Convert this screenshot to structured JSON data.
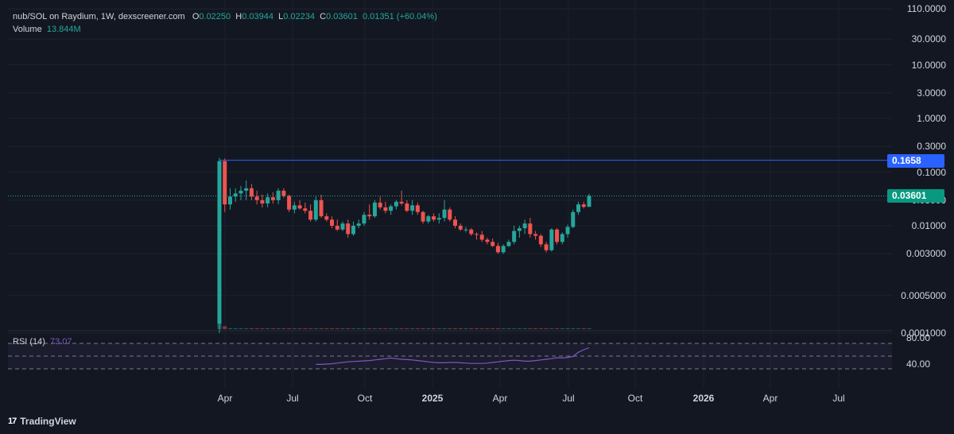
{
  "legend": {
    "pair": "nub/SOL on Raydium, 1W, dexscreener.com",
    "open_key": "O",
    "open": "0.02250",
    "high_key": "H",
    "high": "0.03944",
    "low_key": "L",
    "low": "0.02234",
    "close_key": "C",
    "close": "0.03601",
    "change": "0.01351 (+60.04%)",
    "volume_label": "Volume",
    "volume": "13.844M"
  },
  "rsi_legend": {
    "label": "RSI (14)",
    "value": "73.07",
    "tick_80": "80.00",
    "tick_40": "40.00"
  },
  "price_tags": {
    "line": "0.1658",
    "last": "0.03601"
  },
  "brand": {
    "logo_text": "17",
    "name": "TradingView"
  },
  "colors": {
    "background": "#131722",
    "up": "#26a69a",
    "down": "#ef5350",
    "line": "#2962ff",
    "rsi": "#7e57c2"
  },
  "chart_data": {
    "type": "candlestick",
    "scale": "log",
    "y_ticks": [
      "110.0000",
      "30.0000",
      "10.0000",
      "3.0000",
      "1.0000",
      "0.3000",
      "0.1000",
      "0.03000",
      "0.01000",
      "0.003000",
      "0.0005000",
      "0.0001000"
    ],
    "x_ticks": [
      {
        "label": "Apr",
        "bold": false
      },
      {
        "label": "Jul",
        "bold": false
      },
      {
        "label": "Oct",
        "bold": false
      },
      {
        "label": "2025",
        "bold": true
      },
      {
        "label": "Apr",
        "bold": false
      },
      {
        "label": "Jul",
        "bold": false
      },
      {
        "label": "Oct",
        "bold": false
      },
      {
        "label": "2026",
        "bold": true
      },
      {
        "label": "Apr",
        "bold": false
      },
      {
        "label": "Jul",
        "bold": false
      }
    ],
    "horizontal_line": 0.1658,
    "last_price": 0.03601,
    "candles": [
      [
        0.00015,
        0.185,
        0.0001,
        0.16
      ],
      [
        0.16,
        0.18,
        0.018,
        0.025
      ],
      [
        0.025,
        0.05,
        0.02,
        0.035
      ],
      [
        0.035,
        0.05,
        0.028,
        0.04
      ],
      [
        0.04,
        0.055,
        0.03,
        0.045
      ],
      [
        0.045,
        0.07,
        0.03,
        0.05
      ],
      [
        0.05,
        0.06,
        0.03,
        0.035
      ],
      [
        0.035,
        0.045,
        0.025,
        0.03
      ],
      [
        0.03,
        0.038,
        0.022,
        0.026
      ],
      [
        0.026,
        0.04,
        0.022,
        0.034
      ],
      [
        0.034,
        0.042,
        0.026,
        0.03
      ],
      [
        0.03,
        0.05,
        0.025,
        0.045
      ],
      [
        0.045,
        0.05,
        0.033,
        0.036
      ],
      [
        0.036,
        0.038,
        0.018,
        0.02
      ],
      [
        0.02,
        0.028,
        0.017,
        0.024
      ],
      [
        0.024,
        0.03,
        0.02,
        0.021
      ],
      [
        0.021,
        0.027,
        0.017,
        0.019
      ],
      [
        0.019,
        0.025,
        0.012,
        0.013
      ],
      [
        0.013,
        0.035,
        0.012,
        0.03
      ],
      [
        0.03,
        0.038,
        0.014,
        0.015
      ],
      [
        0.015,
        0.017,
        0.012,
        0.013
      ],
      [
        0.013,
        0.015,
        0.009,
        0.01
      ],
      [
        0.01,
        0.013,
        0.008,
        0.0085
      ],
      [
        0.0085,
        0.012,
        0.008,
        0.011
      ],
      [
        0.011,
        0.013,
        0.006,
        0.007
      ],
      [
        0.007,
        0.012,
        0.0065,
        0.01
      ],
      [
        0.01,
        0.013,
        0.009,
        0.011
      ],
      [
        0.011,
        0.018,
        0.01,
        0.016
      ],
      [
        0.016,
        0.025,
        0.013,
        0.015
      ],
      [
        0.015,
        0.03,
        0.014,
        0.027
      ],
      [
        0.027,
        0.035,
        0.02,
        0.022
      ],
      [
        0.022,
        0.028,
        0.017,
        0.019
      ],
      [
        0.019,
        0.025,
        0.016,
        0.023
      ],
      [
        0.023,
        0.03,
        0.02,
        0.028
      ],
      [
        0.028,
        0.045,
        0.024,
        0.026
      ],
      [
        0.026,
        0.03,
        0.018,
        0.019
      ],
      [
        0.019,
        0.03,
        0.016,
        0.024
      ],
      [
        0.024,
        0.027,
        0.016,
        0.018
      ],
      [
        0.018,
        0.019,
        0.011,
        0.012
      ],
      [
        0.012,
        0.016,
        0.011,
        0.015
      ],
      [
        0.015,
        0.017,
        0.012,
        0.013
      ],
      [
        0.013,
        0.017,
        0.011,
        0.014
      ],
      [
        0.014,
        0.03,
        0.012,
        0.02
      ],
      [
        0.02,
        0.022,
        0.012,
        0.013
      ],
      [
        0.013,
        0.015,
        0.009,
        0.01
      ],
      [
        0.01,
        0.011,
        0.008,
        0.0085
      ],
      [
        0.0085,
        0.0095,
        0.0075,
        0.0085
      ],
      [
        0.0085,
        0.009,
        0.0065,
        0.007
      ],
      [
        0.007,
        0.0075,
        0.0055,
        0.0068
      ],
      [
        0.0068,
        0.008,
        0.005,
        0.0055
      ],
      [
        0.0055,
        0.006,
        0.0045,
        0.005
      ],
      [
        0.005,
        0.0058,
        0.004,
        0.0042
      ],
      [
        0.0042,
        0.0048,
        0.003,
        0.0032
      ],
      [
        0.0032,
        0.0045,
        0.003,
        0.0042
      ],
      [
        0.0042,
        0.0055,
        0.004,
        0.005
      ],
      [
        0.005,
        0.01,
        0.0045,
        0.008
      ],
      [
        0.008,
        0.01,
        0.006,
        0.009
      ],
      [
        0.009,
        0.013,
        0.007,
        0.011
      ],
      [
        0.011,
        0.014,
        0.006,
        0.007
      ],
      [
        0.007,
        0.008,
        0.0055,
        0.0065
      ],
      [
        0.0065,
        0.007,
        0.004,
        0.0045
      ],
      [
        0.0045,
        0.005,
        0.0032,
        0.0035
      ],
      [
        0.0035,
        0.009,
        0.0033,
        0.0085
      ],
      [
        0.0085,
        0.009,
        0.0045,
        0.005
      ],
      [
        0.005,
        0.0075,
        0.0045,
        0.007
      ],
      [
        0.007,
        0.0105,
        0.006,
        0.0095
      ],
      [
        0.0095,
        0.02,
        0.009,
        0.018
      ],
      [
        0.018,
        0.028,
        0.016,
        0.025
      ],
      [
        0.025,
        0.028,
        0.021,
        0.0225
      ],
      [
        0.0225,
        0.03944,
        0.02234,
        0.03601
      ]
    ],
    "volume": [
      10,
      0.6,
      0.2,
      0.15,
      0.12,
      0.1,
      0.08,
      0.08,
      0.07,
      0.06,
      0.06,
      0.05,
      0.05,
      0.05,
      0.04,
      0.04,
      0.04,
      0.05,
      0.06,
      0.05,
      0.04,
      0.04,
      0.03,
      0.03,
      0.04,
      0.03,
      0.03,
      0.04,
      0.05,
      0.08,
      0.05,
      0.04,
      0.04,
      0.05,
      0.1,
      0.05,
      0.04,
      0.05,
      0.04,
      0.03,
      0.03,
      0.03,
      0.07,
      0.04,
      0.03,
      0.03,
      0.03,
      0.02,
      0.02,
      0.02,
      0.02,
      0.02,
      0.02,
      0.02,
      0.02,
      0.02,
      0.02,
      0.03,
      0.03,
      0.02,
      0.02,
      0.02,
      0.03,
      0.02,
      0.02,
      0.03,
      0.04,
      0.05,
      0.04,
      0.06
    ],
    "rsi": [
      47,
      47,
      47.5,
      48,
      49,
      50,
      51,
      51.5,
      52,
      52.5,
      53,
      54,
      55,
      56,
      57,
      56,
      55,
      54.5,
      54,
      53,
      52,
      51,
      50,
      49.5,
      49.5,
      50,
      50,
      49.5,
      49,
      48.5,
      48.5,
      48.5,
      49,
      50,
      51,
      52,
      53,
      53.5,
      53,
      52,
      52,
      53,
      54,
      55,
      56,
      57.5,
      57,
      58,
      59.5,
      66,
      70,
      73.07
    ]
  }
}
